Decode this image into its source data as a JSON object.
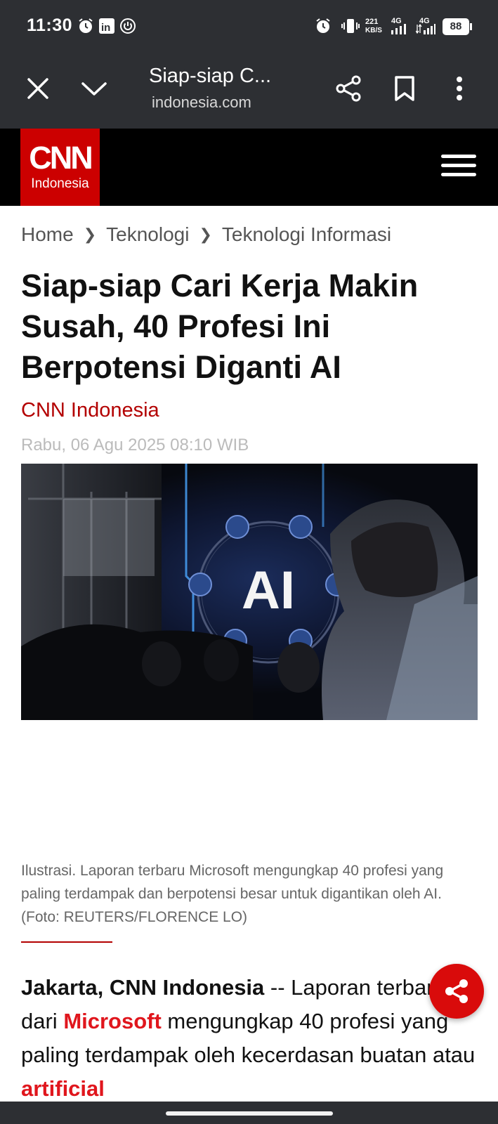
{
  "status_bar": {
    "time": "11:30",
    "icons": [
      "alarm-icon",
      "linkedin-icon",
      "power-icon",
      "alarm-icon",
      "vibrate-icon",
      "signal-4g-icon",
      "signal-4g-icon",
      "battery-icon"
    ],
    "net_speed_value": "221",
    "net_speed_unit": "KB/S",
    "sim1_label": "4G",
    "sim2_label": "4G",
    "battery": "88"
  },
  "browser": {
    "page_title": "Siap-siap C...",
    "domain": "indonesia.com",
    "icons": [
      "close-icon",
      "chevron-down-icon",
      "share-icon",
      "bookmark-icon",
      "more-icon"
    ]
  },
  "site": {
    "logo_word": "CNN",
    "logo_sub": "Indonesia",
    "menu_icon": "hamburger-icon"
  },
  "breadcrumb": [
    "Home",
    "Teknologi",
    "Teknologi Informasi"
  ],
  "article": {
    "headline": "Siap-siap Cari Kerja Makin Susah, 40 Profesi Ini Berpotensi Diganti AI",
    "author": "CNN Indonesia",
    "date": "Rabu, 06 Agu 2025 08:10 WIB",
    "hero_overlay_text": "AI",
    "caption": "Ilustrasi. Laporan terbaru Microsoft mengungkap 40 profesi yang paling terdampak dan berpotensi besar untuk digantikan oleh AI. (Foto: REUTERS/FLORENCE LO)",
    "body": {
      "dateline": "Jakarta, CNN Indonesia",
      "part1": " -- Laporan terbaru dari ",
      "link1": "Microsoft",
      "part2": " mengungkap 40 profesi yang paling terdampak oleh kecerdasan buatan atau ",
      "link2": "artificial"
    }
  },
  "colors": {
    "brand_red": "#cc0000",
    "link_red": "#e0161d",
    "chrome_dark": "#2d2f33"
  }
}
